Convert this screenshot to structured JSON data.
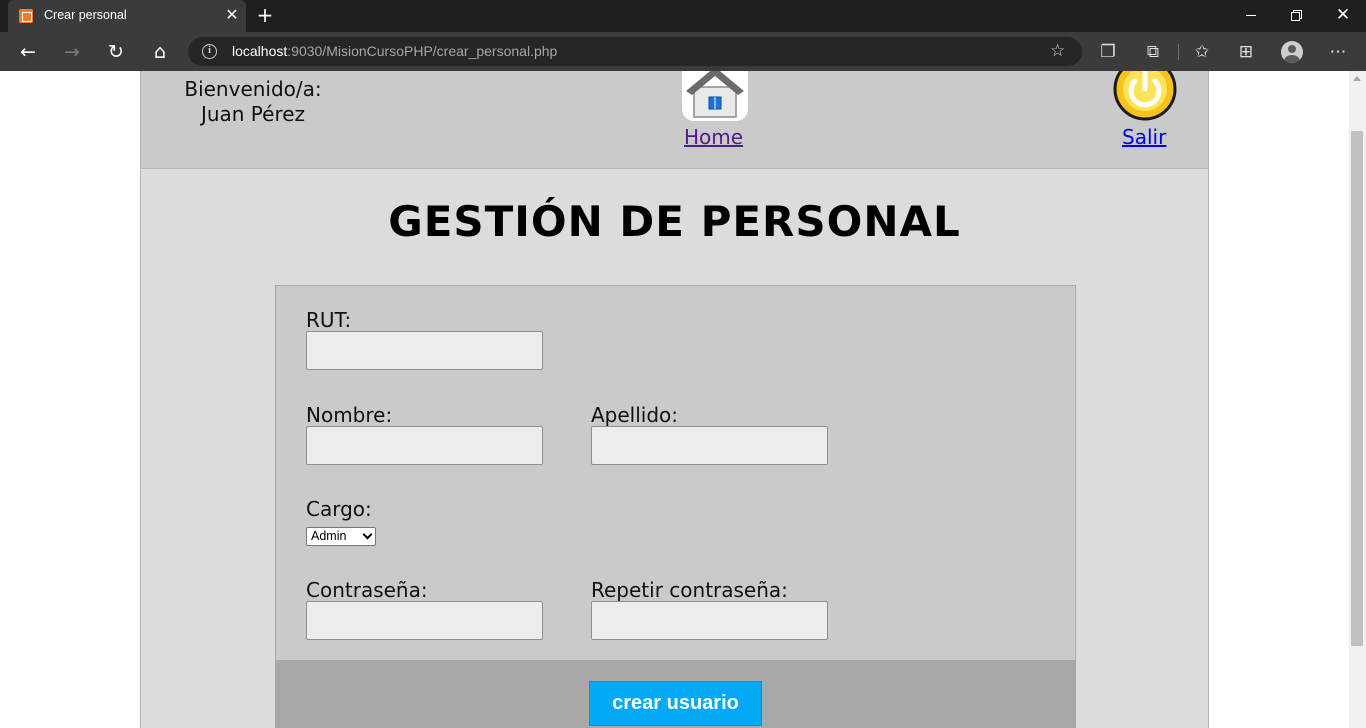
{
  "browser": {
    "tab_title": "Crear personal",
    "tab_close": "✕",
    "new_tab": "+",
    "url_host": "localhost",
    "url_rest": ":9030/MisionCursoPHP/crear_personal.php"
  },
  "header": {
    "welcome_line1": "Bienvenido/a:",
    "welcome_line2": "Juan Pérez",
    "home_label": "Home",
    "logout_label": "Salir"
  },
  "page": {
    "title": "GESTIÓN DE PERSONAL"
  },
  "form": {
    "rut_label": "RUT:",
    "nombre_label": "Nombre:",
    "apellido_label": "Apellido:",
    "cargo_label": "Cargo:",
    "cargo_selected": "Admin",
    "password_label": "Contraseña:",
    "password_repeat_label": "Repetir contraseña:",
    "submit_label": "crear usuario"
  },
  "colors": {
    "submit_bg": "#03a9f4",
    "header_bg": "#cacaca",
    "page_bg": "#dcdcdc",
    "footer_bg": "#a8a8a8"
  }
}
